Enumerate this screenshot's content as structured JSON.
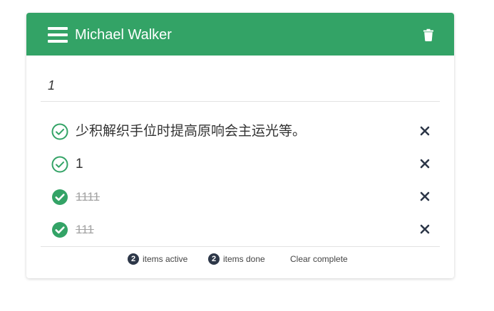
{
  "header": {
    "title": "Michael Walker",
    "menu_icon": "hamburger-menu-icon",
    "trash_icon": "trash-icon",
    "background": "#33a366"
  },
  "new_todo": {
    "value": "1"
  },
  "todos": [
    {
      "text": "少积解织手位时提高原响会主运光等。",
      "done": false
    },
    {
      "text": "1",
      "done": false
    },
    {
      "text": "1111",
      "done": true
    },
    {
      "text": "111",
      "done": true
    }
  ],
  "footer": {
    "active_count": "2",
    "active_label": "items active",
    "done_count": "2",
    "done_label": "items done",
    "clear_label": "Clear complete"
  },
  "colors": {
    "accent": "#33a366",
    "badge": "#2d3748",
    "done_text": "#a3a3a3"
  }
}
